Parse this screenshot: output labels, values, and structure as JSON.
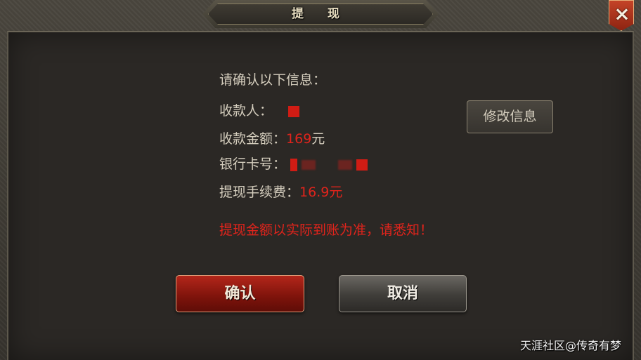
{
  "dialog": {
    "title": "提 现",
    "close_icon": "×"
  },
  "info": {
    "header": "请确认以下信息：",
    "payee_label": "收款人：",
    "amount_label": "收款金额：",
    "amount_value": "169",
    "amount_unit": "元",
    "card_label": "银行卡号：",
    "fee_label": "提现手续费：",
    "fee_value": "16.9",
    "fee_unit": "元",
    "notice": "提现金额以实际到账为准，请悉知！"
  },
  "buttons": {
    "modify": "修改信息",
    "confirm": "确认",
    "cancel": "取消"
  },
  "watermark": "天涯社区@传奇有梦",
  "colors": {
    "accent_red": "#e0241c",
    "text": "#d4cdbd",
    "panel": "#2b2825"
  }
}
